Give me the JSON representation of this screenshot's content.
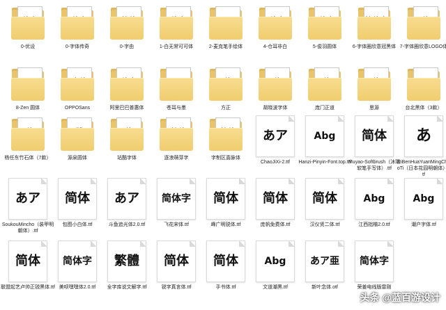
{
  "folders": [
    {
      "label": "0-优设",
      "preview": "体字"
    },
    {
      "label": "0-字体传奇",
      "preview": "体字"
    },
    {
      "label": "0-字由",
      "preview": "简体"
    },
    {
      "label": "1-白无常可可体",
      "preview": "体字"
    },
    {
      "label": "2-麦克笔手绘体",
      "preview": "あア"
    },
    {
      "label": "4-仓耳非白",
      "preview": "体字"
    },
    {
      "label": "5-俊羽圆体",
      "preview": "体字"
    },
    {
      "label": "6-字体圈欣意冠黑体",
      "preview": "简体字"
    },
    {
      "label": "7-字体圈欣意LOGO体",
      "preview": "体"
    },
    {
      "label": "8-Zen 圆体",
      "preview": "Abg"
    },
    {
      "label": "OPPOSans",
      "preview": "字体"
    },
    {
      "label": "阿里巴巴普惠体",
      "preview": "体字"
    },
    {
      "label": "苍耳与墨",
      "preview": "Abg"
    },
    {
      "label": "方正",
      "preview": "体"
    },
    {
      "label": "胡晓波字体",
      "preview": "体"
    },
    {
      "label": "庞门正道",
      "preview": "体"
    },
    {
      "label": "思源",
      "preview": "体"
    },
    {
      "label": "台北黑体（3款）",
      "preview": "黑"
    },
    {
      "label": "杨任东竹石体（7款）",
      "preview": "体"
    },
    {
      "label": "源泉圆体",
      "preview": "體"
    },
    {
      "label": "站酷字体",
      "preview": "体"
    },
    {
      "label": "逐浪萌芽字",
      "preview": "简体"
    },
    {
      "label": "字制区喜脉体",
      "preview": "简体"
    }
  ],
  "files": [
    {
      "label": "ChaoJiXi-2.ttf",
      "preview": "あア"
    },
    {
      "label": "Hanzi-Pinyin-Font.top.ttf",
      "preview": "Abg"
    },
    {
      "label": "Muyao-Softbrush（沐瑶软笔手写体）.ttf",
      "preview": "简体"
    },
    {
      "label": "RiBenHuaYuanMingChaoTi（日本花园明朝体）.ttf",
      "preview": "あ"
    },
    {
      "label": "SoukouMincho（装甲明朝体）.ttf",
      "preview": "あア"
    },
    {
      "label": "包图小白体.ttf",
      "preview": "简体"
    },
    {
      "label": "斗鱼追光体2.0.ttf",
      "preview": "あア"
    },
    {
      "label": "飞花宋体.ttf",
      "preview": "简体字"
    },
    {
      "label": "峰广明锐体.ttf",
      "preview": "简体"
    },
    {
      "label": "庞帆免费体.ttf",
      "preview": "简体"
    },
    {
      "label": "汉仪贤二体.ttf",
      "preview": "简体"
    },
    {
      "label": "江西拙楷2.0.ttf",
      "preview": "Abg"
    },
    {
      "label": "潮户字体.ttf",
      "preview": "Abg"
    },
    {
      "label": "联盟起艺卢帅正锐黑体.ttf",
      "preview": "简体"
    },
    {
      "label": "美呗嘿嘿体2.0.ttf",
      "preview": "简体字"
    },
    {
      "label": "全字库说文解字.ttf",
      "preview": "繁體"
    },
    {
      "label": "锐字真言体.ttf",
      "preview": "简体"
    },
    {
      "label": "手书体.ttf",
      "preview": "简体"
    },
    {
      "label": "文道潮黑.ttf",
      "preview": "Abg"
    },
    {
      "label": "新叶念体.otf",
      "preview": "あア亜"
    },
    {
      "label": "荣姜电线版雷刚",
      "preview": "简体字"
    }
  ],
  "watermark": "头条 @蓝百游设计"
}
